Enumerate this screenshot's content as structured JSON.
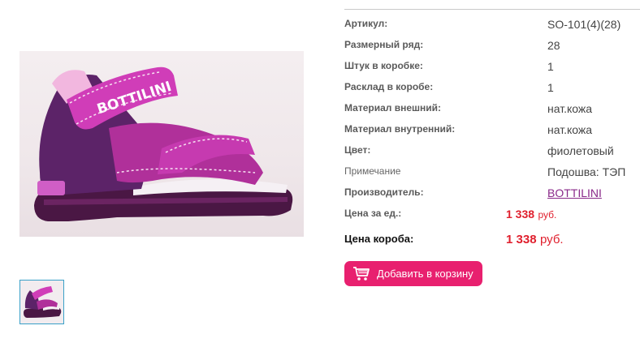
{
  "product": {
    "brand_logo_text": "BOTTILINI"
  },
  "specs": [
    {
      "label": "Артикул:",
      "value": "SO-101(4)(28)"
    },
    {
      "label": "Размерный ряд:",
      "value": "28"
    },
    {
      "label": "Штук в коробке:",
      "value": "1"
    },
    {
      "label": "Расклад в коробе:",
      "value": "1"
    },
    {
      "label": "Материал внешний:",
      "value": "нат.кожа"
    },
    {
      "label": "Материал внутренний:",
      "value": "нат.кожа"
    },
    {
      "label": "Цвет:",
      "value": "фиолетовый"
    },
    {
      "label": "Примечание",
      "value": "Подошва: ТЭП"
    },
    {
      "label": "Производитель:",
      "value": "BOTTILINI"
    }
  ],
  "price_unit": {
    "label": "Цена за ед.:",
    "value": "1 338",
    "currency": "руб."
  },
  "price_box": {
    "label": "Цена короба:",
    "value": "1 338",
    "currency": "руб."
  },
  "cart": {
    "label": "Добавить в корзину",
    "icon": "shopping-cart-icon"
  },
  "colors": {
    "accent": "#e8206f",
    "price": "#e0202e",
    "link": "#8a2a8a",
    "thumb_border": "#3aa0c8"
  }
}
